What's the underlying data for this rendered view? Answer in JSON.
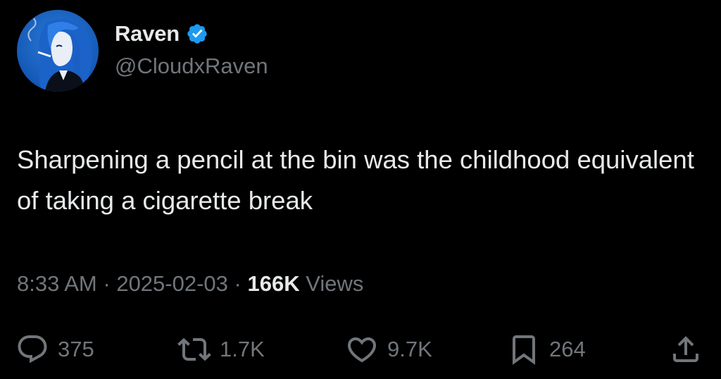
{
  "author": {
    "display_name": "Raven",
    "handle": "@CloudxRaven",
    "verified_icon": "verified-badge-icon",
    "verified_color": "#1d9bf0"
  },
  "tweet": {
    "text": "Sharpening a pencil at the bin was the childhood equivalent of taking a cigarette break"
  },
  "meta": {
    "time": "8:33 AM",
    "separator": "·",
    "date": "2025-02-03",
    "views_count": "166K",
    "views_label": "Views"
  },
  "actions": {
    "replies": {
      "icon": "reply-icon",
      "count": "375"
    },
    "reposts": {
      "icon": "repost-icon",
      "count": "1.7K"
    },
    "likes": {
      "icon": "heart-icon",
      "count": "9.7K"
    },
    "bookmarks": {
      "icon": "bookmark-icon",
      "count": "264"
    },
    "share": {
      "icon": "share-icon"
    }
  },
  "colors": {
    "background": "#000000",
    "primary_text": "#e7e9ea",
    "secondary_text": "#71767b",
    "accent": "#1d9bf0"
  }
}
